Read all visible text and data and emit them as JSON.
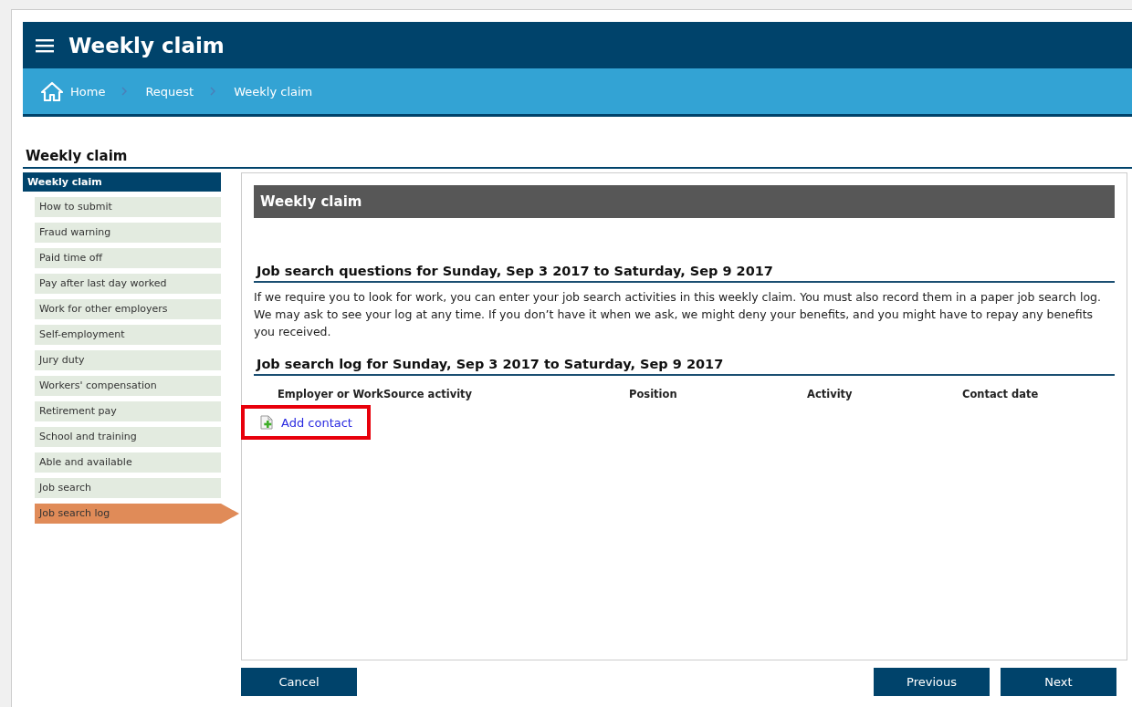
{
  "header": {
    "title": "Weekly claim"
  },
  "breadcrumb": [
    "Home",
    "Request",
    "Weekly claim"
  ],
  "page_title": "Weekly claim",
  "sidebar": {
    "heading": "Weekly claim",
    "items": [
      {
        "label": "How to submit",
        "selected": false
      },
      {
        "label": "Fraud warning",
        "selected": false
      },
      {
        "label": "Paid time off",
        "selected": false
      },
      {
        "label": "Pay after last day worked",
        "selected": false
      },
      {
        "label": "Work for other employers",
        "selected": false
      },
      {
        "label": "Self-employment",
        "selected": false
      },
      {
        "label": "Jury duty",
        "selected": false
      },
      {
        "label": "Workers' compensation",
        "selected": false
      },
      {
        "label": "Retirement pay",
        "selected": false
      },
      {
        "label": "School and training",
        "selected": false
      },
      {
        "label": "Able and available",
        "selected": false
      },
      {
        "label": "Job search",
        "selected": false
      },
      {
        "label": "Job search log",
        "selected": true
      }
    ]
  },
  "panel": {
    "title": "Weekly claim",
    "questions_heading": "Job search questions for Sunday, Sep 3 2017 to Saturday, Sep 9 2017",
    "paragraphs": [
      "If we require you to look for work, you can enter your job search activities in this weekly claim. You must also record them in a paper job search log.",
      "We may ask to see your log at any time. If you don’t have it when we ask, we might deny your benefits, and you might have to repay any benefits you received."
    ],
    "log_heading": "Job search log for Sunday, Sep 3 2017 to Saturday, Sep 9 2017",
    "columns": [
      "Employer or WorkSource activity",
      "Position",
      "Activity",
      "Contact date"
    ],
    "add_contact": {
      "label": "Add contact",
      "highlighted": true
    }
  },
  "buttons": {
    "cancel": "Cancel",
    "previous": "Previous",
    "next": "Next"
  }
}
